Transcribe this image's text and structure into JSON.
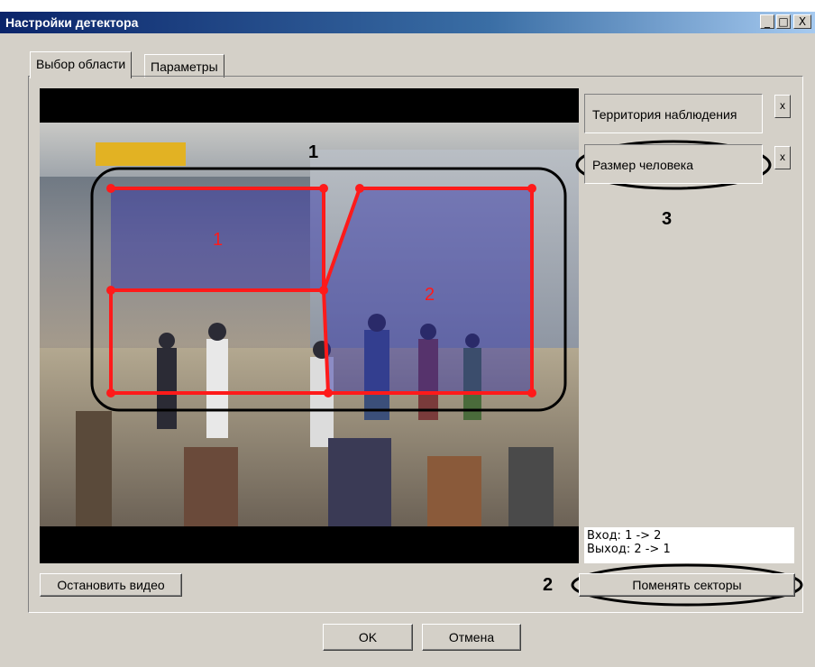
{
  "window": {
    "title": "Настройки детектора",
    "minimize": "_",
    "maximize": "□",
    "close": "X"
  },
  "tabs": [
    {
      "label": "Выбор области"
    },
    {
      "label": "Параметры"
    }
  ],
  "side": {
    "territory_label": "Территория наблюдения",
    "person_size_label": "Размер человека",
    "remove_label": "x"
  },
  "zones": {
    "zone1_label": "1",
    "zone2_label": "2"
  },
  "info": {
    "line1": "Вход: 1 -> 2",
    "line2": "Выход: 2 -> 1"
  },
  "buttons": {
    "stop_video": "Остановить видео",
    "swap_sectors": "Поменять секторы",
    "ok": "OK",
    "cancel": "Отмена"
  },
  "annotations": {
    "n1": "1",
    "n2": "2",
    "n3": "3"
  },
  "colors": {
    "zone_line": "#ff1a1a",
    "zone_fill": "#2a2aa8",
    "title_bar": "#0a246a"
  }
}
